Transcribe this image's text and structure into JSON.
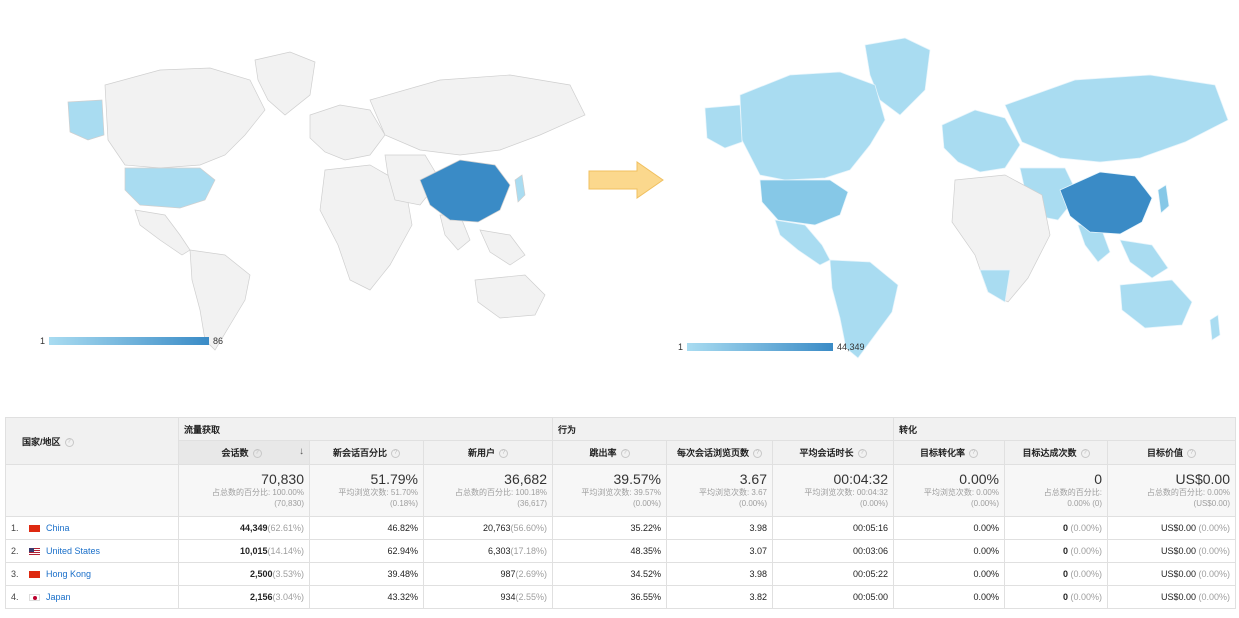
{
  "colors": {
    "land_empty": "#f2f2f2",
    "land_border": "#cfcfcf",
    "light": "#a9dcf1",
    "mid": "#86c8e7",
    "dark": "#3a8bc6",
    "arrow": "#fbd88d",
    "link": "#1a6fc9"
  },
  "maps": {
    "left": {
      "legend_min": "1",
      "legend_max": "86"
    },
    "right": {
      "legend_min": "1",
      "legend_max": "44,349"
    }
  },
  "table": {
    "country_header": "国家/地区",
    "groups": {
      "acquisition": "流量获取",
      "behavior": "行为",
      "conversion": "转化"
    },
    "metrics": [
      "会话数",
      "新会话百分比",
      "新用户",
      "跳出率",
      "每次会话浏览页数",
      "平均会话时长",
      "目标转化率",
      "目标达成次数",
      "目标价值"
    ],
    "totals": [
      {
        "value": "70,830",
        "sub1": "占总数的百分比: 100.00%",
        "sub2": "(70,830)"
      },
      {
        "value": "51.79%",
        "sub1": "平均浏览次数: 51.70%",
        "sub2": "(0.18%)"
      },
      {
        "value": "36,682",
        "sub1": "占总数的百分比: 100.18%",
        "sub2": "(36,617)"
      },
      {
        "value": "39.57%",
        "sub1": "平均浏览次数: 39.57%",
        "sub2": "(0.00%)"
      },
      {
        "value": "3.67",
        "sub1": "平均浏览次数: 3.67",
        "sub2": "(0.00%)"
      },
      {
        "value": "00:04:32",
        "sub1": "平均浏览次数: 00:04:32",
        "sub2": "(0.00%)"
      },
      {
        "value": "0.00%",
        "sub1": "平均浏览次数: 0.00%",
        "sub2": "(0.00%)"
      },
      {
        "value": "0",
        "sub1": "占总数的百分比:",
        "sub2": "0.00% (0)"
      },
      {
        "value": "US$0.00",
        "sub1": "占总数的百分比: 0.00%",
        "sub2": "(US$0.00)"
      }
    ],
    "rows": [
      {
        "rank": "1.",
        "country": "China",
        "sessions": "44,349",
        "sessions_pct": "(62.61%)",
        "new_sessions": "46.82%",
        "new_users": "20,763",
        "new_users_pct": "(56.60%)",
        "bounce": "35.22%",
        "pages": "3.98",
        "duration": "00:05:16",
        "conv_rate": "0.00%",
        "completions": "0",
        "completions_pct": "(0.00%)",
        "value": "US$0.00",
        "value_pct": "(0.00%)"
      },
      {
        "rank": "2.",
        "country": "United States",
        "sessions": "10,015",
        "sessions_pct": "(14.14%)",
        "new_sessions": "62.94%",
        "new_users": "6,303",
        "new_users_pct": "(17.18%)",
        "bounce": "48.35%",
        "pages": "3.07",
        "duration": "00:03:06",
        "conv_rate": "0.00%",
        "completions": "0",
        "completions_pct": "(0.00%)",
        "value": "US$0.00",
        "value_pct": "(0.00%)"
      },
      {
        "rank": "3.",
        "country": "Hong Kong",
        "sessions": "2,500",
        "sessions_pct": "(3.53%)",
        "new_sessions": "39.48%",
        "new_users": "987",
        "new_users_pct": "(2.69%)",
        "bounce": "34.52%",
        "pages": "3.98",
        "duration": "00:05:22",
        "conv_rate": "0.00%",
        "completions": "0",
        "completions_pct": "(0.00%)",
        "value": "US$0.00",
        "value_pct": "(0.00%)"
      },
      {
        "rank": "4.",
        "country": "Japan",
        "sessions": "2,156",
        "sessions_pct": "(3.04%)",
        "new_sessions": "43.32%",
        "new_users": "934",
        "new_users_pct": "(2.55%)",
        "bounce": "36.55%",
        "pages": "3.82",
        "duration": "00:05:00",
        "conv_rate": "0.00%",
        "completions": "0",
        "completions_pct": "(0.00%)",
        "value": "US$0.00",
        "value_pct": "(0.00%)"
      }
    ]
  }
}
